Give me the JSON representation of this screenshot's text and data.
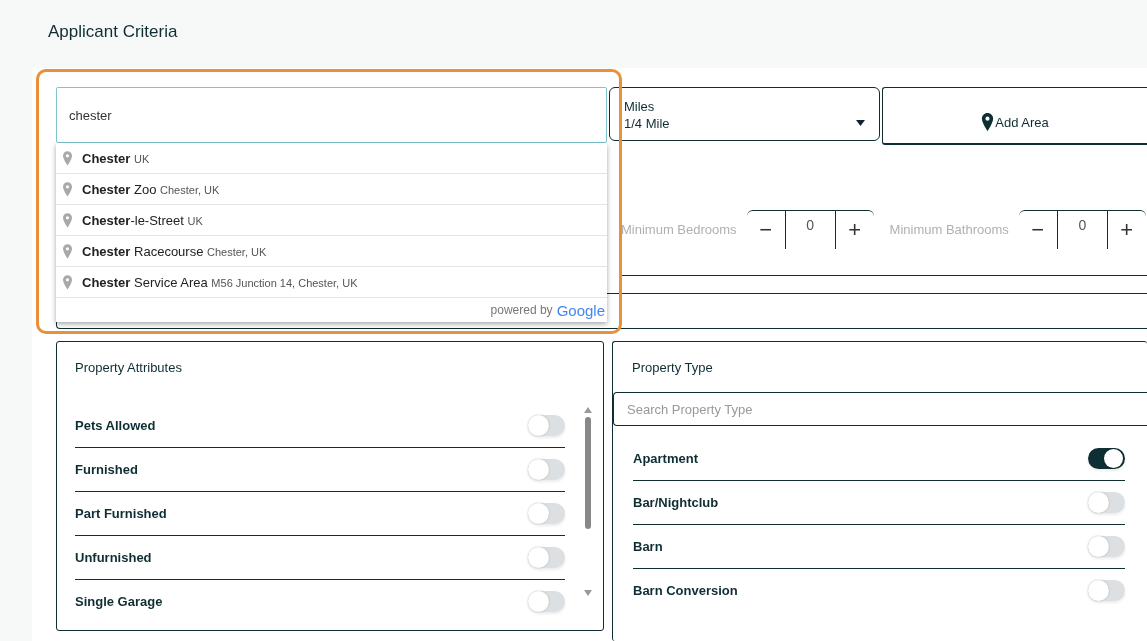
{
  "title": "Applicant Criteria",
  "location_search": {
    "value": "chester"
  },
  "suggestions": [
    {
      "match": "Chester",
      "detail": "UK"
    },
    {
      "match": "Chester",
      "rest": " Zoo",
      "detail": "Chester, UK"
    },
    {
      "match": "Chester",
      "rest": "-le-Street",
      "detail": "UK"
    },
    {
      "match": "Chester",
      "rest": " Racecourse",
      "detail": "Chester, UK"
    },
    {
      "match": "Chester",
      "rest": " Service Area",
      "detail": "M56 Junction 14, Chester, UK"
    }
  ],
  "attribution": {
    "text": "powered by",
    "brand": "Google"
  },
  "miles": {
    "label": "Miles",
    "value": "1/4 Mile"
  },
  "add_area": {
    "label": "Add Area"
  },
  "steppers": [
    {
      "label": "Minimum Bedrooms",
      "minus": "−",
      "value": "0",
      "plus": "+"
    },
    {
      "label": "Minimum Bathrooms",
      "minus": "−",
      "value": "0",
      "plus": "+"
    }
  ],
  "property_attributes": {
    "title": "Property Attributes",
    "items": [
      {
        "label": "Pets Allowed",
        "on": false
      },
      {
        "label": "Furnished",
        "on": false
      },
      {
        "label": "Part Furnished",
        "on": false
      },
      {
        "label": "Unfurnished",
        "on": false
      },
      {
        "label": "Single Garage",
        "on": false
      }
    ]
  },
  "property_type": {
    "title": "Property Type",
    "search_placeholder": "Search Property Type",
    "items": [
      {
        "label": "Apartment",
        "on": true
      },
      {
        "label": "Bar/Nightclub",
        "on": false
      },
      {
        "label": "Barn",
        "on": false
      },
      {
        "label": "Barn Conversion",
        "on": false
      }
    ]
  }
}
